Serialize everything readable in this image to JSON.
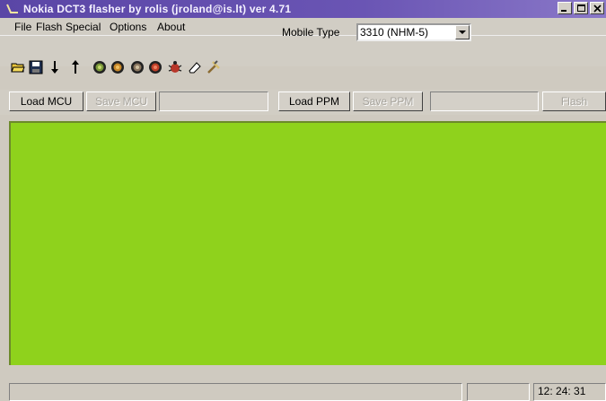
{
  "window": {
    "title": "Nokia DCT3 flasher by rolis (jroland@is.lt) ver 4.71"
  },
  "menu": [
    {
      "label": "File"
    },
    {
      "label": "Flash"
    },
    {
      "label": "Special"
    },
    {
      "label": "Options"
    },
    {
      "label": "About"
    }
  ],
  "toolbar": {
    "mobile_type_label": "Mobile Type",
    "mobile_type_value": "3310 (NHM-5)"
  },
  "actions": {
    "load_mcu": "Load MCU",
    "save_mcu": "Save MCU",
    "load_ppm": "Load PPM",
    "save_ppm": "Save PPM",
    "flash": "Flash"
  },
  "statusbar": {
    "time": "12: 24: 31"
  },
  "colors": {
    "title_bg": "#5a46a6",
    "main_area": "#8fd21c",
    "face": "#d4d0c8"
  }
}
